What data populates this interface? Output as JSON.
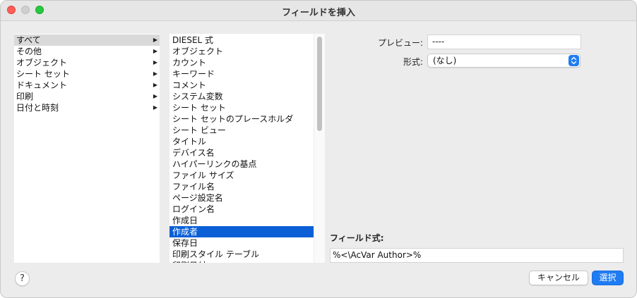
{
  "window": {
    "title": "フィールドを挿入"
  },
  "categories": [
    {
      "label": "すべて",
      "selected": true
    },
    {
      "label": "その他"
    },
    {
      "label": "オブジェクト"
    },
    {
      "label": "シート セット"
    },
    {
      "label": "ドキュメント"
    },
    {
      "label": "印刷"
    },
    {
      "label": "日付と時刻"
    }
  ],
  "fields": [
    {
      "label": "DIESEL 式"
    },
    {
      "label": "オブジェクト"
    },
    {
      "label": "カウント"
    },
    {
      "label": "キーワード"
    },
    {
      "label": "コメント"
    },
    {
      "label": "システム変数"
    },
    {
      "label": "シート セット"
    },
    {
      "label": "シート セットのプレースホルダ"
    },
    {
      "label": "シート ビュー"
    },
    {
      "label": "タイトル"
    },
    {
      "label": "デバイス名"
    },
    {
      "label": "ハイパーリンクの基点"
    },
    {
      "label": "ファイル サイズ"
    },
    {
      "label": "ファイル名"
    },
    {
      "label": "ページ設定名"
    },
    {
      "label": "ログイン名"
    },
    {
      "label": "作成日"
    },
    {
      "label": "作成者",
      "selected": true
    },
    {
      "label": "保存日"
    },
    {
      "label": "印刷スタイル テーブル"
    },
    {
      "label": "印刷日付"
    }
  ],
  "preview": {
    "label": "プレビュー:",
    "value": "----"
  },
  "format": {
    "label": "形式:",
    "value": "(なし)"
  },
  "formula": {
    "label": "フィールド式:",
    "value": "%<\\AcVar Author>%"
  },
  "buttons": {
    "help": "?",
    "cancel": "キャンセル",
    "select": "選択"
  },
  "colors": {
    "accent": "#1f7cf2",
    "selection": "#0a5fd6",
    "category_selection": "#d9d9d9"
  }
}
